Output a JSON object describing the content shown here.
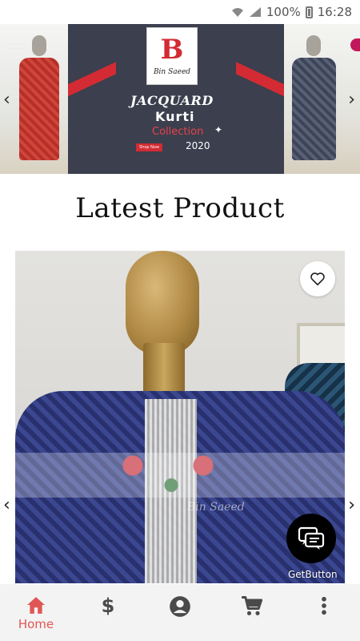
{
  "status_bar": {
    "battery": "100%",
    "time": "16:28"
  },
  "banner": {
    "brand": "Bin Saeed",
    "headline": "JACQUARD",
    "product": "Kurti",
    "collection": "Collection",
    "year": "2020",
    "shop_now": "Shop Now"
  },
  "main": {
    "section_title": "Latest Product",
    "product_watermark": "Bin Saeed"
  },
  "chat_widget": {
    "label": "GetButton"
  },
  "bottom_nav": {
    "items": [
      {
        "label": "Home",
        "icon": "home-icon",
        "active": true
      },
      {
        "label": "",
        "icon": "dollar-icon",
        "active": false
      },
      {
        "label": "",
        "icon": "account-icon",
        "active": false
      },
      {
        "label": "",
        "icon": "cart-icon",
        "active": false
      },
      {
        "label": "",
        "icon": "more-vert-icon",
        "active": false
      }
    ]
  },
  "colors": {
    "accent": "#e05654",
    "brand_red": "#d22b33",
    "nav_bg": "#f3f3f3",
    "icon_gray": "#4a4a4a"
  }
}
